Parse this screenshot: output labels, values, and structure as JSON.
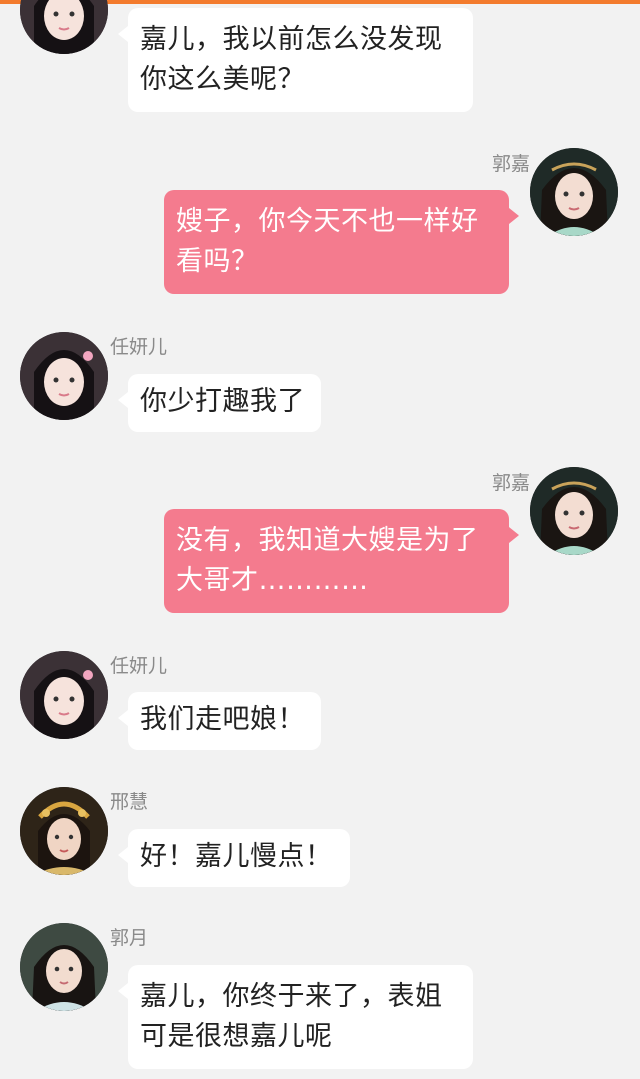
{
  "colors": {
    "top_bar": "#f37b2d",
    "background": "#f2f2f2",
    "left_bubble": "#ffffff",
    "right_bubble": "#f47b8e",
    "name_text": "#8a8a8a"
  },
  "messages": [
    {
      "sender": "",
      "side": "left",
      "avatar": "renyaner-avatar-icon",
      "text": "嘉儿，我以前怎么没发现\n你这么美呢？"
    },
    {
      "sender": "郭嘉",
      "side": "right",
      "avatar": "guojia-avatar-icon",
      "text": "嫂子，你今天不也一样好\n看吗？"
    },
    {
      "sender": "任妍儿",
      "side": "left",
      "avatar": "renyaner-avatar-icon",
      "text": "你少打趣我了"
    },
    {
      "sender": "郭嘉",
      "side": "right",
      "avatar": "guojia-avatar-icon",
      "text": "没有，我知道大嫂是为了\n大哥才…………"
    },
    {
      "sender": "任妍儿",
      "side": "left",
      "avatar": "renyaner-avatar-icon",
      "text": "我们走吧娘！"
    },
    {
      "sender": "邢慧",
      "side": "left",
      "avatar": "xinghui-avatar-icon",
      "text": "好！嘉儿慢点！"
    },
    {
      "sender": "郭月",
      "side": "left",
      "avatar": "guoyue-avatar-icon",
      "text": "嘉儿，你终于来了，表姐\n可是很想嘉儿呢"
    }
  ]
}
